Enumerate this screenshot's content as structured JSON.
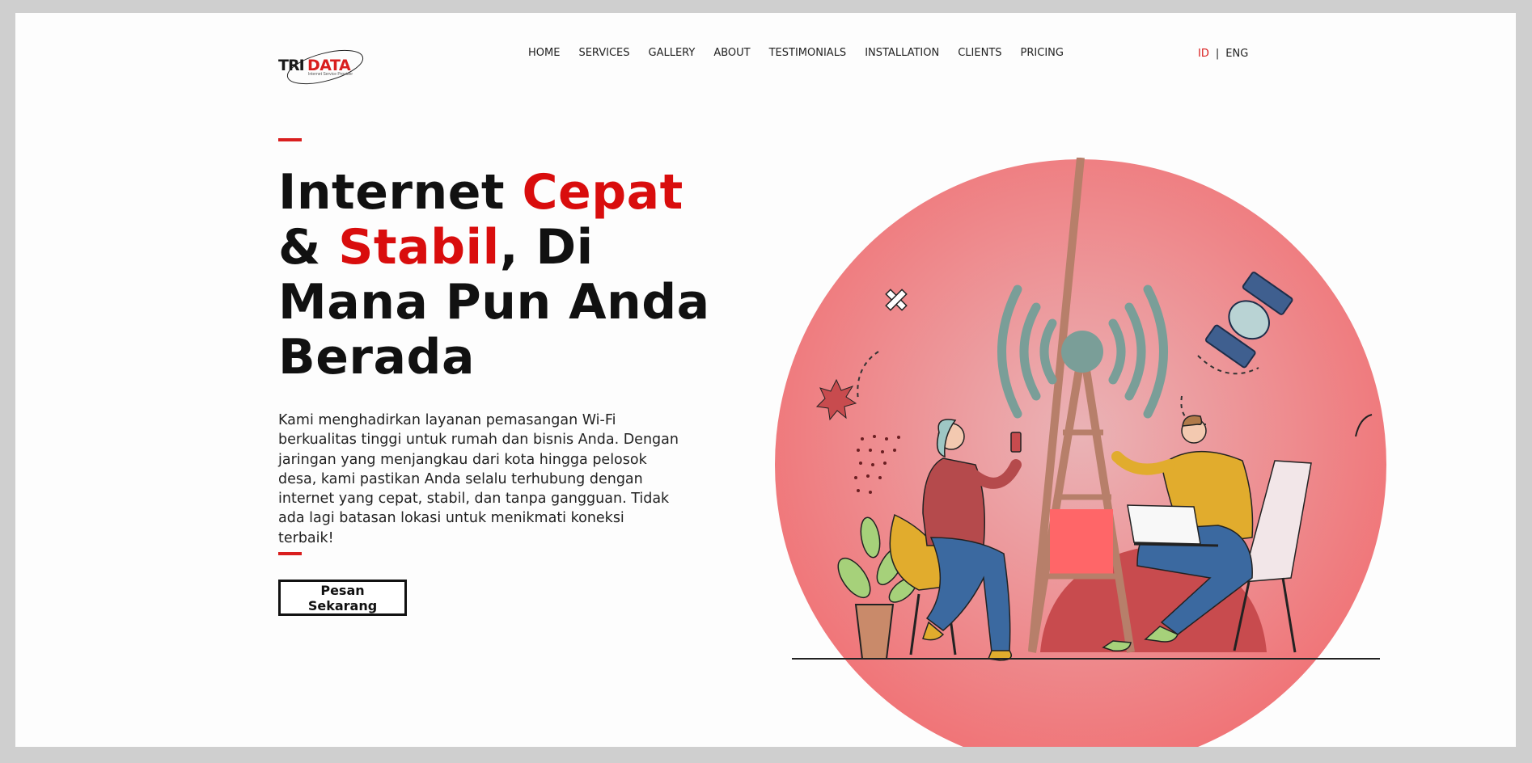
{
  "brand": {
    "logo_word1": "TRI",
    "logo_word2": "DATA",
    "tagline": "Internet Service Provider"
  },
  "nav": {
    "items": [
      "HOME",
      "SERVICES",
      "GALLERY",
      "ABOUT",
      "TESTIMONIALS",
      "INSTALLATION",
      "CLIENTS",
      "PRICING"
    ]
  },
  "lang": {
    "id": "ID",
    "separator": "|",
    "en": "ENG",
    "active": "ID"
  },
  "hero": {
    "title_part1": "Internet ",
    "title_red1": "Cepat",
    "title_part2": "& ",
    "title_red2": "Stabil",
    "title_part3": ", Di Mana Pun Anda Berada",
    "description": "Kami menghadirkan layanan pemasangan Wi-Fi berkualitas tinggi untuk rumah dan bisnis Anda. Dengan jaringan yang menjangkau dari kota hingga pelosok desa, kami pastikan Anda selalu terhubung dengan internet yang cepat, stabil, dan tanpa gangguan. Tidak ada lagi batasan lokasi untuk menikmati koneksi terbaik!",
    "cta_label": "Pesan Sekarang"
  },
  "colors": {
    "accent": "#d91e1e",
    "circle": "#f0787a",
    "background": "#fdfdfd",
    "outer": "#cfcfcf"
  },
  "illustration": {
    "icons": [
      "wifi-tower-icon",
      "satellite-icon",
      "woman-with-phone",
      "man-with-laptop",
      "potted-plant-icon"
    ]
  }
}
